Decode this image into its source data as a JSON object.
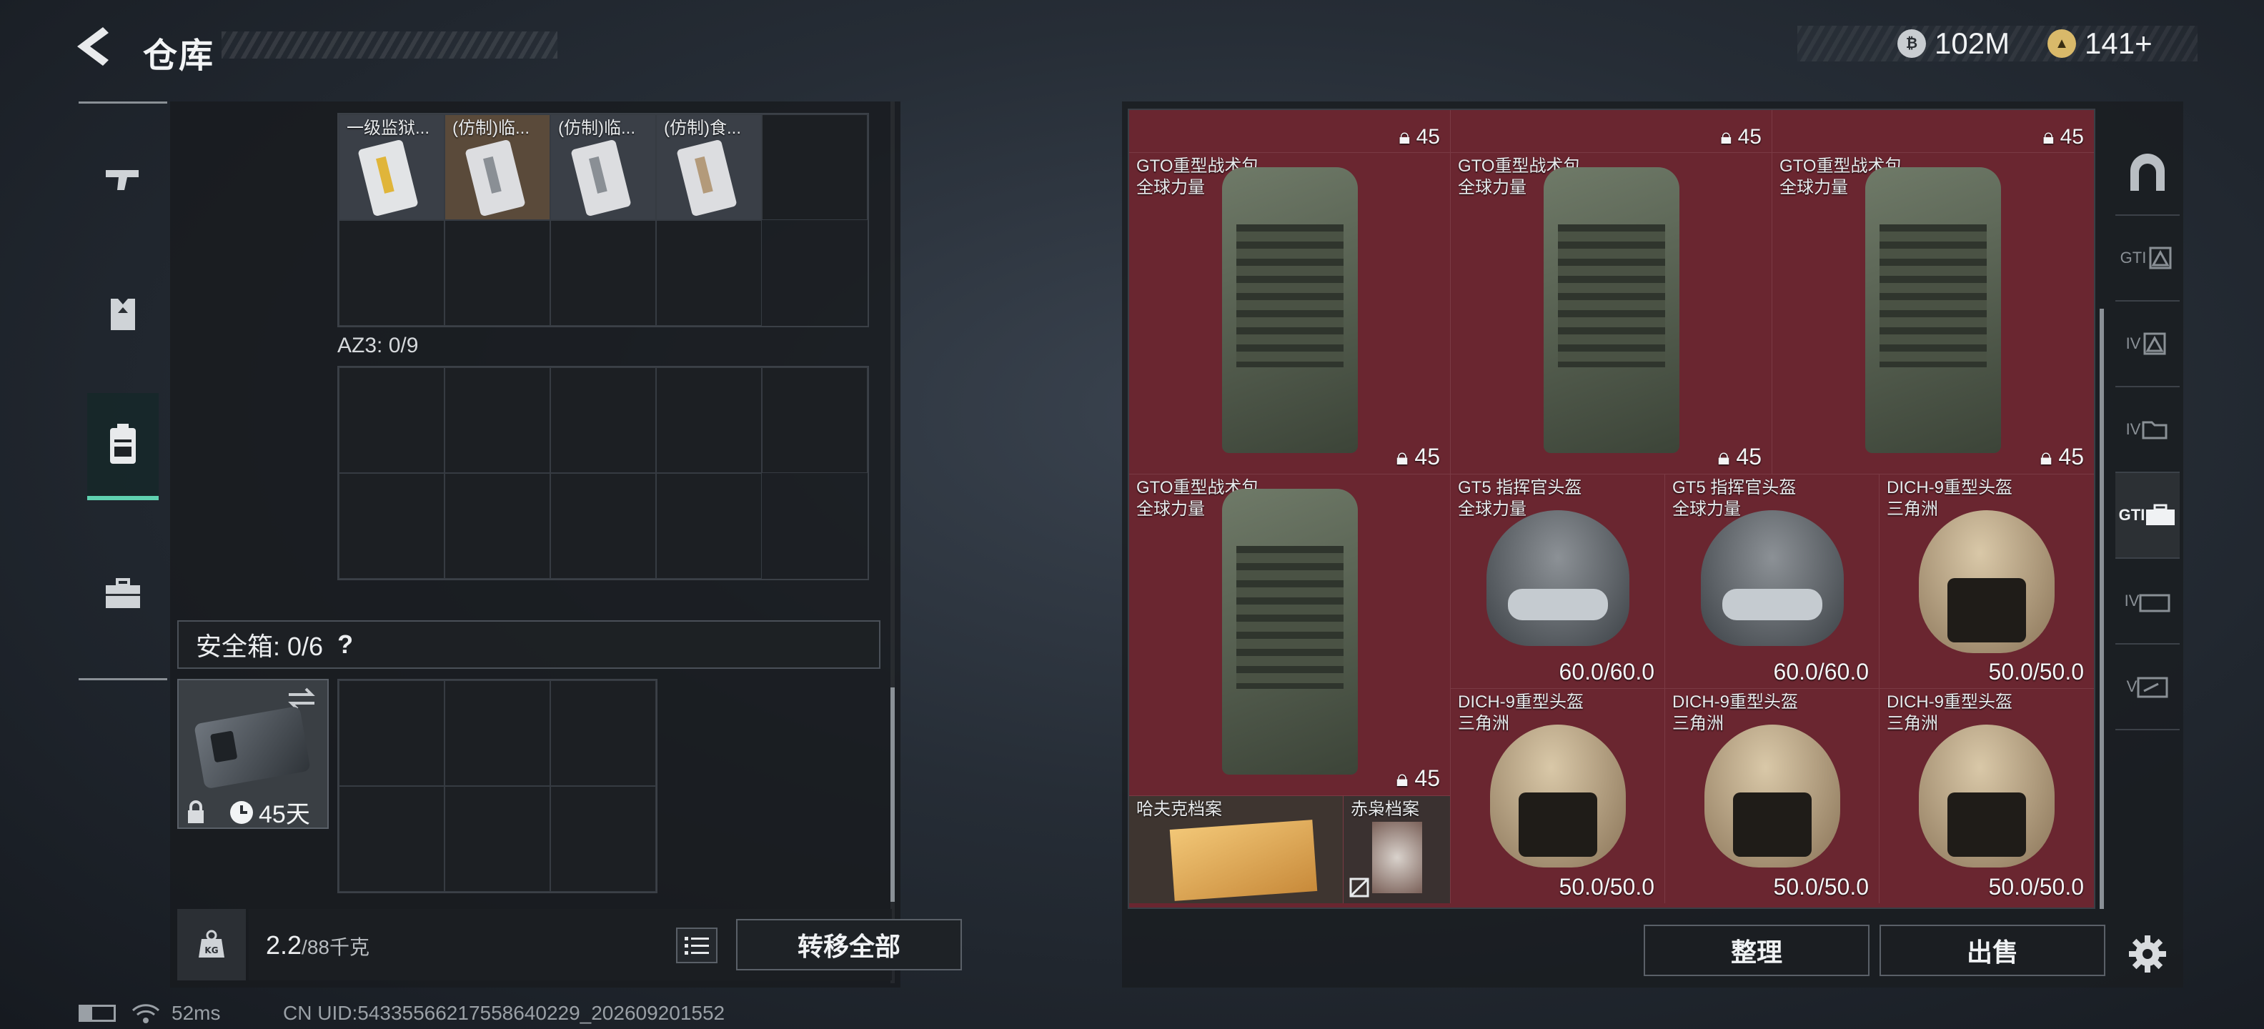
{
  "header": {
    "title": "仓库"
  },
  "currency": {
    "coin": "102M",
    "premium": "141+"
  },
  "left_rail": [
    "weapons",
    "armor",
    "backpack",
    "safebox"
  ],
  "rig": {
    "items": [
      {
        "name": "一级监狱..."
      },
      {
        "name": "(仿制)临..."
      },
      {
        "name": "(仿制)临..."
      },
      {
        "name": "(仿制)食..."
      }
    ]
  },
  "az3": {
    "label": "AZ3: 0/9"
  },
  "safebox": {
    "label": "安全箱: 0/6",
    "help": "?",
    "duration": "45天"
  },
  "weight": {
    "current": "2.2",
    "max": "/88千克"
  },
  "buttons": {
    "transfer_all": "转移全部",
    "sort": "整理",
    "sell": "出售"
  },
  "stash": {
    "top_counts": [
      "45",
      "45",
      "45"
    ],
    "backpacks": [
      {
        "name": "GTO重型战术包",
        "brand": "全球力量",
        "count": "45"
      },
      {
        "name": "GTO重型战术包",
        "brand": "全球力量",
        "count": "45"
      },
      {
        "name": "GTO重型战术包",
        "brand": "全球力量",
        "count": "45"
      },
      {
        "name": "GTO重型战术包",
        "brand": "全球力量",
        "count": "45"
      }
    ],
    "helmets": [
      {
        "name": "GT5 指挥官头盔",
        "brand": "全球力量",
        "durability": "60.0/60.0"
      },
      {
        "name": "GT5 指挥官头盔",
        "brand": "全球力量",
        "durability": "60.0/60.0"
      },
      {
        "name": "DICH-9重型头盔",
        "brand": "三角洲",
        "durability": "50.0/50.0"
      },
      {
        "name": "DICH-9重型头盔",
        "brand": "三角洲",
        "durability": "50.0/50.0"
      },
      {
        "name": "DICH-9重型头盔",
        "brand": "三角洲",
        "durability": "50.0/50.0"
      },
      {
        "name": "DICH-9重型头盔",
        "brand": "三角洲",
        "durability": "50.0/50.0"
      }
    ],
    "files": [
      {
        "name": "哈夫克档案"
      },
      {
        "name": "赤枭档案"
      }
    ]
  },
  "right_tabs": [
    "all",
    "GTI",
    "IV",
    "IV",
    "GTI",
    "IV",
    "V"
  ],
  "status": {
    "ping": "52ms",
    "uid": "CN UID:54335566217558640229_202609201552"
  },
  "colors": {
    "accent": "#5fd1b0",
    "stash_bg": "#6a2630"
  }
}
